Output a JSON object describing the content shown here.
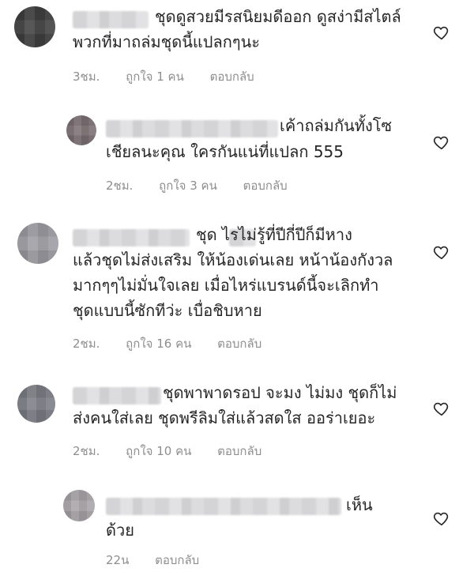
{
  "comments": [
    {
      "lines": [
        "ชุดดูสวยมีรสนิยมดีออก ดูสง่ามีสไตล์",
        "พวกที่มาถล่มชุดนี้แปลกๆนะ"
      ],
      "time": "3ชม.",
      "likes": "ถูกใจ 1 คน",
      "reply": "ตอบกลับ"
    },
    {
      "lines": [
        "เค้าถล่มกันทั้งโซ",
        "เชียลนะคุณ ใครกันแน่ที่แปลก 555"
      ],
      "time": "2ชม.",
      "likes": "ถูกใจ 3 คน",
      "reply": "ตอบกลับ"
    },
    {
      "lines": [
        "ชุด ไรไม่รู้ที่ปีกี่ปีก็มีหาง",
        "แล้วชุดไม่ส่งเสริม ให้น้องเด่นเลย หน้าน้องกังวล",
        "มากๆๆไม่มั่นใจเลย เมื่อไหร่แบรนด์นี้จะเลิกทำ",
        "ชุดแบบนี้ซักทีว่ะ เบื่อชิบหาย"
      ],
      "time": "2ชม.",
      "likes": "ถูกใจ 16 คน",
      "reply": "ตอบกลับ"
    },
    {
      "lines": [
        "ชุดพาพาดรอป จะมง ไม่มง ชุดก็ไม่",
        "ส่งคนใส่เลย ชุดพรีลิมใส่แล้วสดใส ออร่าเยอะ"
      ],
      "time": "2ชม.",
      "likes": "ถูกใจ 10 คน",
      "reply": "ตอบกลับ"
    },
    {
      "lines": [
        "เห็น",
        "ด้วย"
      ],
      "time": "22น",
      "reply": "ตอบกลับ"
    }
  ],
  "icons": {
    "like": "heart-outline-icon"
  },
  "colors": {
    "text": "#262626",
    "meta": "#8e8e8e",
    "heart": "#262626"
  }
}
